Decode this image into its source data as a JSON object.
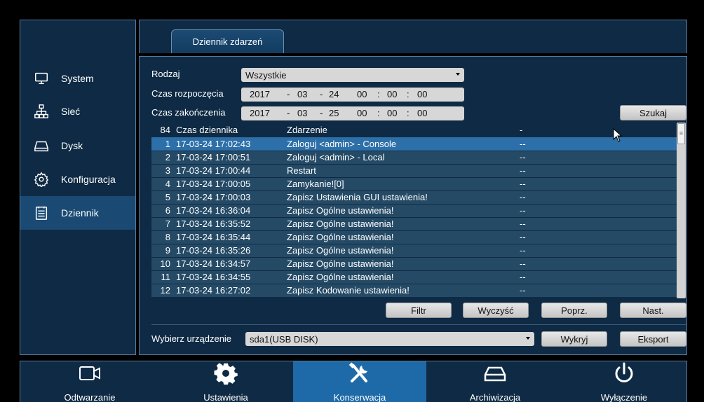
{
  "tab": {
    "label": "Dziennik zdarzeń"
  },
  "sidebar": {
    "items": [
      {
        "label": "System",
        "icon": "monitor-icon"
      },
      {
        "label": "Sieć",
        "icon": "network-icon"
      },
      {
        "label": "Dysk",
        "icon": "disk-icon"
      },
      {
        "label": "Konfiguracja",
        "icon": "gear-outline-icon"
      },
      {
        "label": "Dziennik",
        "icon": "log-icon",
        "active": true
      }
    ]
  },
  "filters": {
    "type_label": "Rodzaj",
    "type_value": "Wszystkie",
    "start_label": "Czas rozpoczęcia",
    "start": {
      "year": "2017",
      "month": "03",
      "day": "24",
      "hour": "00",
      "min": "00",
      "sec": "00"
    },
    "end_label": "Czas zakończenia",
    "end": {
      "year": "2017",
      "month": "03",
      "day": "25",
      "hour": "00",
      "min": "00",
      "sec": "00"
    },
    "date_sep": "-",
    "time_sep": ":",
    "search_label": "Szukaj"
  },
  "table": {
    "count": "84",
    "headers": [
      "Czas dziennika",
      "Zdarzenie",
      "-"
    ],
    "rows": [
      {
        "n": "1",
        "time": "17-03-24 17:02:43",
        "event": "Zaloguj <admin> - Console",
        "extra": "--"
      },
      {
        "n": "2",
        "time": "17-03-24 17:00:51",
        "event": "Zaloguj <admin> - Local",
        "extra": "--"
      },
      {
        "n": "3",
        "time": "17-03-24 17:00:44",
        "event": "Restart",
        "extra": "--"
      },
      {
        "n": "4",
        "time": "17-03-24 17:00:05",
        "event": "Zamykanie![0]",
        "extra": "--"
      },
      {
        "n": "5",
        "time": "17-03-24 17:00:03",
        "event": "Zapisz Ustawienia GUI ustawienia!",
        "extra": "--"
      },
      {
        "n": "6",
        "time": "17-03-24 16:36:04",
        "event": "Zapisz Ogólne ustawienia!",
        "extra": "--"
      },
      {
        "n": "7",
        "time": "17-03-24 16:35:52",
        "event": "Zapisz Ogólne ustawienia!",
        "extra": "--"
      },
      {
        "n": "8",
        "time": "17-03-24 16:35:44",
        "event": "Zapisz Ogólne ustawienia!",
        "extra": "--"
      },
      {
        "n": "9",
        "time": "17-03-24 16:35:26",
        "event": "Zapisz Ogólne ustawienia!",
        "extra": "--"
      },
      {
        "n": "10",
        "time": "17-03-24 16:34:57",
        "event": "Zapisz Ogólne ustawienia!",
        "extra": "--"
      },
      {
        "n": "11",
        "time": "17-03-24 16:34:55",
        "event": "Zapisz Ogólne ustawienia!",
        "extra": "--"
      },
      {
        "n": "12",
        "time": "17-03-24 16:27:02",
        "event": "Zapisz Kodowanie ustawienia!",
        "extra": "--"
      }
    ],
    "selected_index": 0
  },
  "actions": {
    "filter": "Filtr",
    "clear": "Wyczyść",
    "prev": "Poprz.",
    "next": "Nast."
  },
  "device": {
    "label": "Wybierz urządzenie",
    "value": "sda1(USB DISK)",
    "detect": "Wykryj",
    "export": "Eksport"
  },
  "bottom": {
    "items": [
      {
        "label": "Odtwarzanie",
        "icon": "video-camera-icon"
      },
      {
        "label": "Ustawienia",
        "icon": "gear-icon"
      },
      {
        "label": "Konserwacja",
        "icon": "tools-icon",
        "active": true
      },
      {
        "label": "Archiwizacja",
        "icon": "drive-icon"
      },
      {
        "label": "Wyłączenie",
        "icon": "power-icon"
      }
    ]
  },
  "colors": {
    "panel": "#0e2a44",
    "selected_row": "#2d6fa8",
    "row": "#254a66",
    "active_nav": "#1e6aa8"
  }
}
